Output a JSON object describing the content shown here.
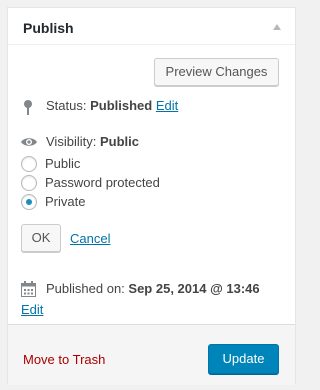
{
  "panel": {
    "title": "Publish",
    "colors": {
      "accent": "#0085ba",
      "link": "#0073aa",
      "trash": "#a00"
    }
  },
  "actions": {
    "preview_label": "Preview Changes"
  },
  "status": {
    "label": "Status:",
    "value": "Published",
    "edit_label": "Edit",
    "icon": "pin-icon"
  },
  "visibility": {
    "label": "Visibility:",
    "value": "Public",
    "icon": "eye-icon",
    "options": [
      {
        "label": "Public",
        "checked": false
      },
      {
        "label": "Password protected",
        "checked": false
      },
      {
        "label": "Private",
        "checked": true
      }
    ],
    "ok_label": "OK",
    "cancel_label": "Cancel"
  },
  "published": {
    "label": "Published on:",
    "value": "Sep 25, 2014 @ 13:46",
    "edit_label": "Edit",
    "icon": "calendar-icon"
  },
  "footer": {
    "trash_label": "Move to Trash",
    "update_label": "Update"
  }
}
